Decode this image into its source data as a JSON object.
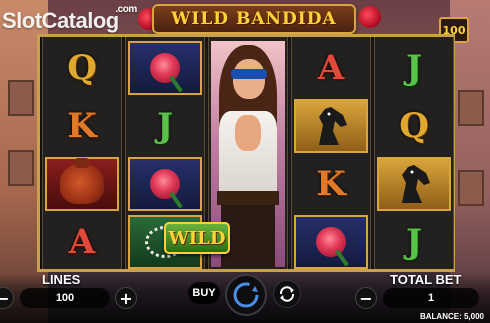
{
  "branding": {
    "site_logo": "SlotCatalog",
    "site_logo_suffix": ".com"
  },
  "game": {
    "title": "WILD BANDIDA",
    "bet_level": "100"
  },
  "reels": [
    [
      "Q",
      "K",
      "money-bag",
      "A"
    ],
    [
      "rose",
      "J",
      "rose",
      "pearl-necklace"
    ],
    [
      "bandida-wild"
    ],
    [
      "A",
      "black-horse",
      "K",
      "rose"
    ],
    [
      "J",
      "Q",
      "black-horse",
      "J"
    ]
  ],
  "wild_label": "WILD",
  "controls": {
    "lines_label": "LINES",
    "lines_value": "100",
    "total_bet_label": "TOTAL BET",
    "total_bet_value": "1",
    "buy_label": "BUY",
    "balance_text": "BALANCE: 5,000"
  },
  "colors": {
    "accent_gold": "#d9a441",
    "title_yellow": "#ffd23a",
    "mask_blue": "#1a4fb0"
  }
}
